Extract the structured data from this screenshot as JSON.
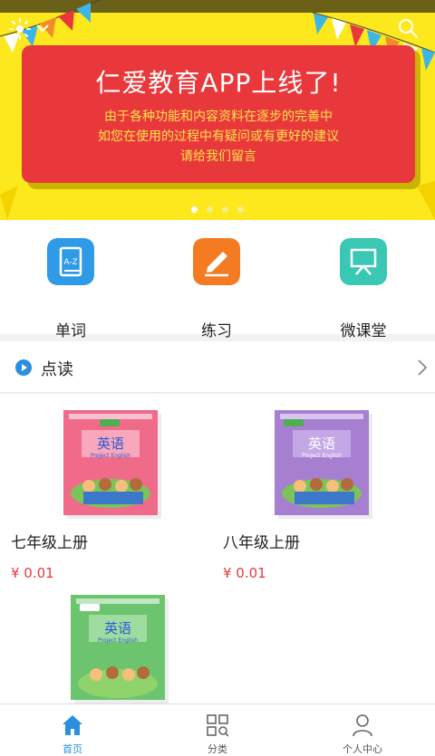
{
  "banner": {
    "title": "仁爱教育APP上线了!",
    "line1": "由于各种功能和内容资料在逐步的完善中",
    "line2": "如您在使用的过程中有疑问或有更好的建议",
    "line3": "请给我们留言",
    "slide_count": 4,
    "active_slide": 1
  },
  "shortcuts": [
    {
      "label": "单词",
      "icon": "a-z-book-icon",
      "color": "#2f9ae6"
    },
    {
      "label": "练习",
      "icon": "pen-edit-icon",
      "color": "#f47b22"
    },
    {
      "label": "微课堂",
      "icon": "presentation-board-icon",
      "color": "#3ac7b3"
    }
  ],
  "section": {
    "title": "点读",
    "icon": "play-circle-icon"
  },
  "books": [
    {
      "name": "七年级上册",
      "price": "¥ 0.01",
      "cover_title": "英语",
      "cover_sub": "Project English",
      "cover_color": "#f06a8a"
    },
    {
      "name": "八年级上册",
      "price": "¥ 0.01",
      "cover_title": "英语",
      "cover_sub": "Project English",
      "cover_color": "#a77fd0"
    },
    {
      "name": "",
      "price": "",
      "cover_title": "英语",
      "cover_sub": "Project English",
      "cover_color": "#6cc46e"
    }
  ],
  "tabbar": [
    {
      "label": "首页",
      "icon": "home-icon",
      "active": true
    },
    {
      "label": "分类",
      "icon": "category-grid-icon",
      "active": false
    },
    {
      "label": "个人中心",
      "icon": "person-icon",
      "active": false
    }
  ],
  "colors": {
    "accent": "#2a8fe0",
    "price": "#e8383b",
    "banner_bg": "#fde81e",
    "banner_card": "#e8383b"
  }
}
